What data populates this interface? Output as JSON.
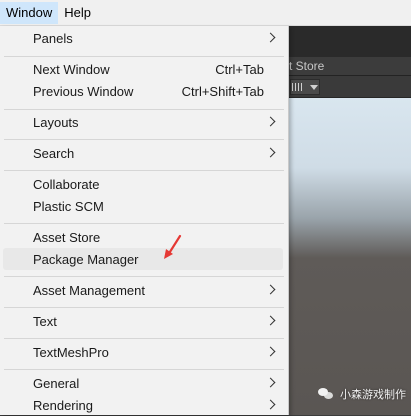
{
  "menubar": {
    "window": "Window",
    "help": "Help"
  },
  "unity": {
    "tab_label": "t Store"
  },
  "menu": {
    "panels": "Panels",
    "next_window": "Next Window",
    "next_window_shortcut": "Ctrl+Tab",
    "previous_window": "Previous Window",
    "previous_window_shortcut": "Ctrl+Shift+Tab",
    "layouts": "Layouts",
    "search": "Search",
    "collaborate": "Collaborate",
    "plastic_scm": "Plastic SCM",
    "asset_store": "Asset Store",
    "package_manager": "Package Manager",
    "asset_management": "Asset Management",
    "text": "Text",
    "textmeshpro": "TextMeshPro",
    "general": "General",
    "rendering": "Rendering"
  },
  "watermark": {
    "text": "小森游戏制作"
  },
  "colors": {
    "annotation_arrow": "#e53935",
    "menu_bg": "#f2f2f2",
    "highlight": "#e8e8e8"
  }
}
